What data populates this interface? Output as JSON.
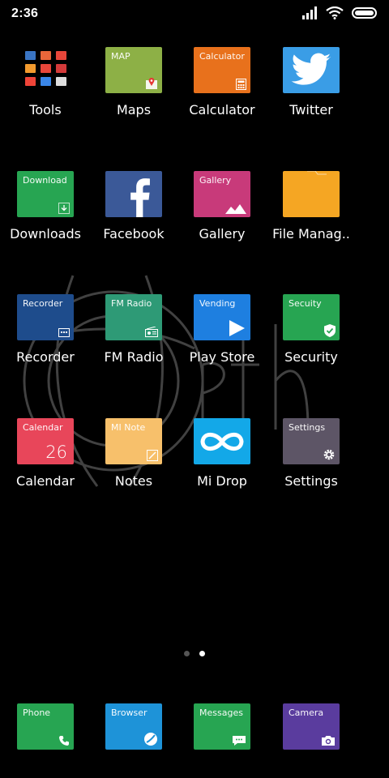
{
  "status_bar": {
    "time": "2:36",
    "icons": [
      "signal-icon",
      "wifi-icon",
      "battery-icon"
    ]
  },
  "apps": [
    {
      "id": "tools",
      "name": "Tools",
      "tile_label": "",
      "color": "#000000",
      "icon": "tools-grid-icon"
    },
    {
      "id": "maps",
      "name": "Maps",
      "tile_label": "MAP",
      "color": "#8DB046",
      "icon": "map-pin-icon"
    },
    {
      "id": "calculator",
      "name": "Calculator",
      "tile_label": "Calculator",
      "color": "#E8711C",
      "icon": "calculator-icon"
    },
    {
      "id": "twitter",
      "name": "Twitter",
      "tile_label": "",
      "color": "#3A9DE6",
      "icon": "twitter-bird-icon"
    },
    {
      "id": "downloads",
      "name": "Downloads",
      "tile_label": "Download",
      "color": "#27A552",
      "icon": "download-icon"
    },
    {
      "id": "facebook",
      "name": "Facebook",
      "tile_label": "",
      "color": "#3B5998",
      "icon": "facebook-f-icon"
    },
    {
      "id": "gallery",
      "name": "Gallery",
      "tile_label": "Gallery",
      "color": "#C83A7A",
      "icon": "mountain-image-icon"
    },
    {
      "id": "file-manager",
      "name": "File Manag..",
      "tile_label": "",
      "color": "#F5A623",
      "icon": "folder-icon"
    },
    {
      "id": "recorder",
      "name": "Recorder",
      "tile_label": "Recorder",
      "color": "#1E4C8C",
      "icon": "recorder-icon"
    },
    {
      "id": "fm-radio",
      "name": "FM Radio",
      "tile_label": "FM Radio",
      "color": "#2E9A76",
      "icon": "radio-icon"
    },
    {
      "id": "play-store",
      "name": "Play Store",
      "tile_label": "Vending",
      "color": "#1E7FE0",
      "icon": "play-triangle-icon"
    },
    {
      "id": "security",
      "name": "Security",
      "tile_label": "Secuity",
      "color": "#27A552",
      "icon": "shield-check-icon"
    },
    {
      "id": "calendar",
      "name": "Calendar",
      "tile_label": "Calendar",
      "color": "#E8465A",
      "icon": "calendar-number",
      "value": "26"
    },
    {
      "id": "notes",
      "name": "Notes",
      "tile_label": "MI Note",
      "color": "#F7C06B",
      "icon": "pencil-note-icon"
    },
    {
      "id": "mi-drop",
      "name": "Mi Drop",
      "tile_label": "",
      "color": "#13A8E8",
      "icon": "infinity-icon"
    },
    {
      "id": "settings",
      "name": "Settings",
      "tile_label": "Settings",
      "color": "#5D5566",
      "icon": "gear-icon"
    }
  ],
  "dock": [
    {
      "id": "phone",
      "tile_label": "Phone",
      "color": "#27A552",
      "icon": "phone-icon"
    },
    {
      "id": "browser",
      "tile_label": "Browser",
      "color": "#1E93D8",
      "icon": "globe-icon"
    },
    {
      "id": "messages",
      "tile_label": "Messages",
      "color": "#27A552",
      "icon": "message-bubble-icon"
    },
    {
      "id": "camera",
      "tile_label": "Camera",
      "color": "#5A3C9E",
      "icon": "camera-icon"
    }
  ],
  "page_indicator": {
    "pages": 2,
    "current": 2
  }
}
